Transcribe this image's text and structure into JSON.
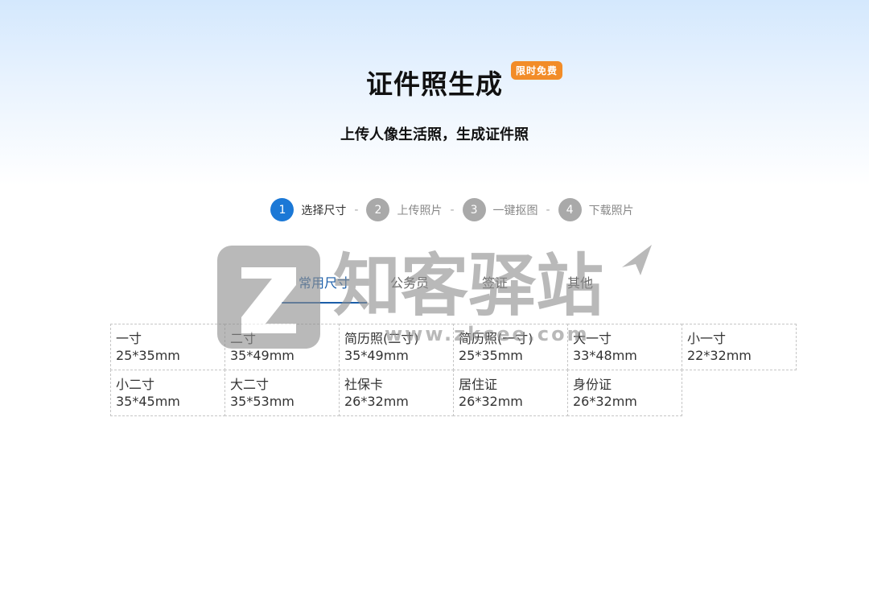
{
  "header": {
    "title": "证件照生成",
    "badge": "限时免费",
    "subtitle": "上传人像生活照，生成证件照"
  },
  "steps": [
    {
      "num": "1",
      "label": "选择尺寸",
      "active": true
    },
    {
      "num": "2",
      "label": "上传照片",
      "active": false
    },
    {
      "num": "3",
      "label": "一键抠图",
      "active": false
    },
    {
      "num": "4",
      "label": "下载照片",
      "active": false
    }
  ],
  "step_separator": "-",
  "tabs": [
    {
      "label": "常用尺寸",
      "active": true
    },
    {
      "label": "公务员",
      "active": false
    },
    {
      "label": "签证",
      "active": false
    },
    {
      "label": "其他",
      "active": false
    }
  ],
  "sizes": [
    {
      "name": "一寸",
      "size": "25*35mm"
    },
    {
      "name": "二寸",
      "size": "35*49mm"
    },
    {
      "name": "简历照(二寸)",
      "size": "35*49mm"
    },
    {
      "name": "简历照(一寸)",
      "size": "25*35mm"
    },
    {
      "name": "大一寸",
      "size": "33*48mm"
    },
    {
      "name": "小一寸",
      "size": "22*32mm"
    },
    {
      "name": "小二寸",
      "size": "35*45mm"
    },
    {
      "name": "大二寸",
      "size": "35*53mm"
    },
    {
      "name": "社保卡",
      "size": "26*32mm"
    },
    {
      "name": "居住证",
      "size": "26*32mm"
    },
    {
      "name": "身份证",
      "size": "26*32mm"
    }
  ],
  "watermark": {
    "brand": "知客驿站",
    "url": "www.zkcee.com"
  },
  "colors": {
    "accent": "#1b78d6",
    "tab_active": "#1b5ea8",
    "badge": "#f28c28",
    "step_inactive": "#a9a9a9"
  }
}
